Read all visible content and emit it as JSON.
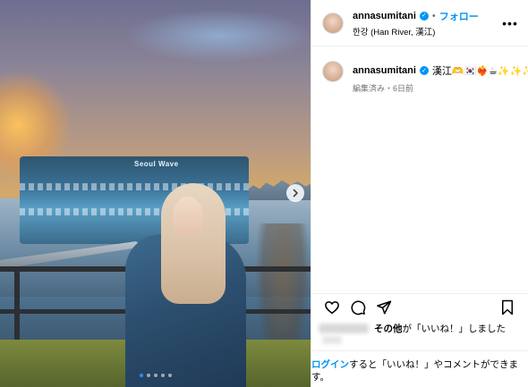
{
  "header": {
    "username": "annasumitani",
    "separator": "•",
    "follow_label": "フォロー",
    "location": "한강 (Han River, 漢江)",
    "more_label": "•••"
  },
  "photo": {
    "building_sign": "Seoul Wave",
    "carousel_dots": 5,
    "active_dot": 0
  },
  "caption": {
    "username": "annasumitani",
    "text": "漢江🫶🇰🇷❤️‍🔥☕✨✨✨",
    "meta": "編集済み・6日前"
  },
  "likes": {
    "suffix_bold": "その他",
    "suffix": "が「いいね！」しました"
  },
  "login_prompt": {
    "link": "ログイン",
    "text": "すると「いいね！」やコメントができます。"
  },
  "colors": {
    "accent": "#0095f6",
    "border": "#efefef",
    "secondary_text": "#737373"
  },
  "icons": [
    "heart-icon",
    "comment-icon",
    "share-icon",
    "bookmark-icon",
    "verified-badge-icon",
    "chevron-right-icon",
    "more-options-icon"
  ]
}
